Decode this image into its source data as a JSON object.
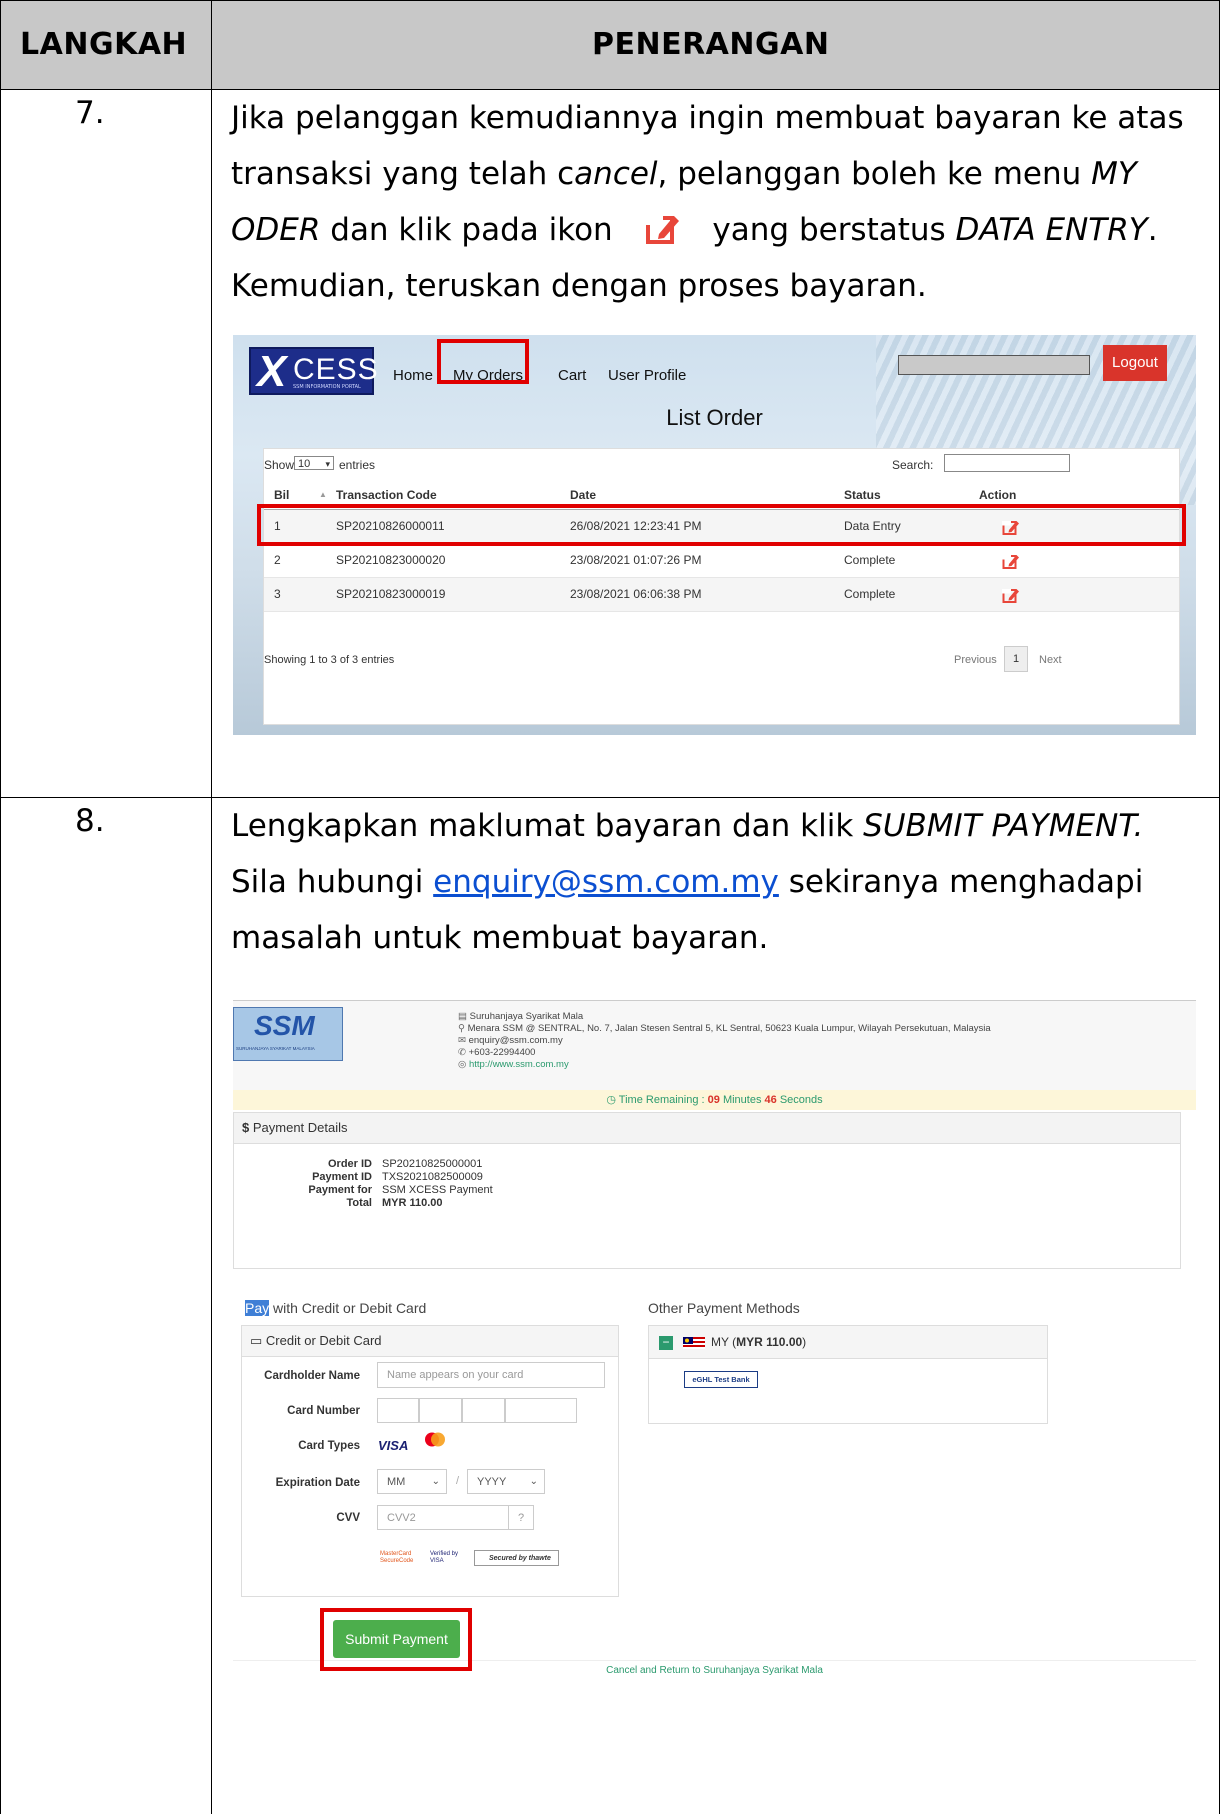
{
  "table_header": {
    "col1": "LANGKAH",
    "col2": "PENERANGAN"
  },
  "step7": {
    "number": "7.",
    "line1": "Jika pelanggan kemudiannya ingin membuat bayaran ke atas",
    "line2_a": "transaksi yang telah c",
    "line2_b": "ancel",
    "line2_c": ", pelanggan boleh ke menu ",
    "line2_d": "MY",
    "line3_a": "ODER",
    "line3_b": " dan klik pada ikon ",
    "line3_c": " yang berstatus ",
    "line3_d": "DATA ENTRY",
    "line3_e": ".",
    "line4": "Kemudian, teruskan dengan proses bayaran."
  },
  "shot1": {
    "logo_x": "X",
    "logo_cess": "CESS",
    "logo_sub": "SSM INFORMATION PORTAL",
    "nav": [
      "Home",
      "My Orders",
      "Cart",
      "User Profile"
    ],
    "logout": "Logout",
    "title": "List Order",
    "show": "Show",
    "entries_value": "10",
    "entries": "entries",
    "search": "Search:",
    "headers": [
      "Bil",
      "Transaction Code",
      "Date",
      "Status",
      "Action"
    ],
    "rows": [
      {
        "bil": "1",
        "code": "SP20210826000011",
        "date": "26/08/2021 12:23:41 PM",
        "status": "Data Entry"
      },
      {
        "bil": "2",
        "code": "SP20210823000020",
        "date": "23/08/2021 01:07:26 PM",
        "status": "Complete"
      },
      {
        "bil": "3",
        "code": "SP20210823000019",
        "date": "23/08/2021 06:06:38 PM",
        "status": "Complete"
      }
    ],
    "showing": "Showing 1 to 3 of 3 entries",
    "previous": "Previous",
    "page": "1",
    "next": "Next",
    "accent": "#e00000"
  },
  "step8": {
    "number": "8.",
    "line1_a": "Lengkapkan maklumat bayaran dan klik ",
    "line1_b": "SUBMIT PAYMENT.",
    "line2_a": "Sila hubungi ",
    "line2_link": "enquiry@ssm.com.my",
    "line2_b": " sekiranya menghadapi",
    "line3": "masalah untuk membuat bayaran."
  },
  "shot2": {
    "ssm_logo": "SSM",
    "ssm_logo_sub": "SURUHANJAYA SYARIKAT MALAYSIA",
    "org": "Suruhanjaya Syarikat Mala",
    "address": "Menara SSM @ SENTRAL, No. 7, Jalan Stesen Sentral 5, KL Sentral, 50623 Kuala Lumpur, Wilayah Persekutuan, Malaysia",
    "email": "enquiry@ssm.com.my",
    "phone": "+603-22994400",
    "website": "http://www.ssm.com.my",
    "timer_label": "Time Remaining : ",
    "timer_min": "09",
    "timer_min_label": " Minutes ",
    "timer_sec": "46",
    "timer_sec_label": " Seconds",
    "payment_details": "Payment Details",
    "details": [
      {
        "k": "Order ID",
        "v": "SP20210825000001"
      },
      {
        "k": "Payment ID",
        "v": "TXS2021082500009"
      },
      {
        "k": "Payment for",
        "v": "SSM XCESS Payment"
      },
      {
        "k": "Total",
        "v": "MYR 110.00"
      }
    ],
    "pay_hl": "Pay",
    "pay_rest": " with Credit or Debit Card",
    "other_methods": "Other Payment Methods",
    "cc_title": "Credit or Debit Card",
    "cardholder_label": "Cardholder Name",
    "cardholder_placeholder": "Name appears on your card",
    "card_number_label": "Card Number",
    "card_types_label": "Card Types",
    "visa": "VISA",
    "expiration_label": "Expiration Date",
    "mm": "MM",
    "slash": "/",
    "yyyy": "YYYY",
    "cvv_label": "CVV",
    "cvv_placeholder": "CVV2",
    "mastercard_sc": "MasterCard SecureCode",
    "verified_visa": "Verified by VISA",
    "secured_by": "Secured by thawte",
    "submit": "Submit Payment",
    "my_prefix": "MY (",
    "my_amount": "MYR 110.00",
    "my_suffix": ")",
    "egh": "eGHL Test Bank",
    "cancel": "Cancel and Return to Suruhanjaya Syarikat Mala"
  }
}
